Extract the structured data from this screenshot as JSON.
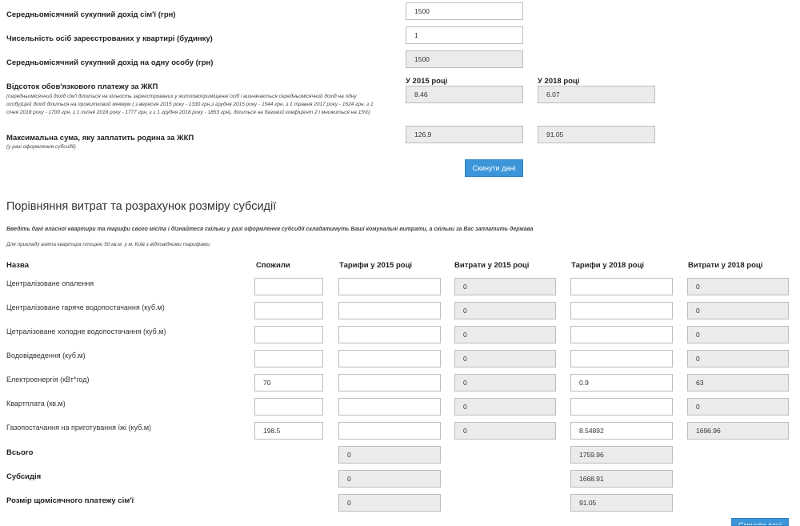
{
  "top": {
    "income_label": "Середньомісячний сукупний дохід сім'ї (грн)",
    "income_value": "1500",
    "persons_label": "Чисельність осіб зареєстрованих у квартирі (будинку)",
    "persons_value": "1",
    "per_person_label": "Середньомісячний сукупний дохід на одну особу (грн)",
    "per_person_value": "1500",
    "year_2015_label": "У 2015 році",
    "year_2018_label": "У 2018 році",
    "percent_label": "Відсоток обов'язкового платежу за ЖКП",
    "percent_note": "(середньомісячний дохід сім'ї ділиться на кількість зареєстрованих у житлово­приміщенні осіб і визначається середньомісячний дохід на одну особу)Цей дохід ділиться на прожитковий мінімум ( з вересня 2015 року - 1330 грн,з грудня 2015 року - 1544 грн, з 1 травня 2017 року - 1624 грн, з 1 січня 2018 року - 1700 грн, з 1 липня 2018 року - 1777 грн, з з 1 грудня 2018 року - 1853 грн), ділиться на базовий коефіцієнт 2 і множиться на 15%)",
    "percent_2015": "8.46",
    "percent_2018": "6.07",
    "max_label": "Максимальна сума, яку заплатить родина за ЖКП",
    "max_note": "(у разі оформлення субсидії)",
    "max_2015": "126.9",
    "max_2018": "91.05",
    "reset_label": "Скинути дані"
  },
  "section": {
    "title": "Порівняння витрат та розрахунок розміру субсидії",
    "intro": "Введіть дані власної квартири та тарифи свого міста і дізнайтеся скільки у разі оформлення субсидії складатимуть Ваші комунальні витрати, а скільки за Вас заплатить держава",
    "example": "Для прикладу взята квартира площею 50 кв.м. у м. Київ з відповідними тарифами."
  },
  "table": {
    "headers": [
      "Назва",
      "Спожили",
      "Тарифи у 2015 році",
      "Витрати у 2015 році",
      "Тарифи у 2018 році",
      "Витрати у 2018 році"
    ],
    "rows": [
      {
        "name": "Централізоване опалення",
        "consumed": "",
        "tariff_2015": "",
        "cost_2015": "0",
        "tariff_2018": "",
        "cost_2018": "0"
      },
      {
        "name": "Централізоване гаряче водопостачання (куб.м)",
        "consumed": "",
        "tariff_2015": "",
        "cost_2015": "0",
        "tariff_2018": "",
        "cost_2018": "0"
      },
      {
        "name": "Цетралізоване холодне водопостачання (куб.м)",
        "consumed": "",
        "tariff_2015": "",
        "cost_2015": "0",
        "tariff_2018": "",
        "cost_2018": "0"
      },
      {
        "name": "Водовідведення (куб.м)",
        "consumed": "",
        "tariff_2015": "",
        "cost_2015": "0",
        "tariff_2018": "",
        "cost_2018": "0"
      },
      {
        "name": "Електроенергія (кВт*год)",
        "consumed": "70",
        "tariff_2015": "",
        "cost_2015": "0",
        "tariff_2018": "0.9",
        "cost_2018": "63"
      },
      {
        "name": "Квартплата (кв.м)",
        "consumed": "",
        "tariff_2015": "",
        "cost_2015": "0",
        "tariff_2018": "",
        "cost_2018": "0"
      },
      {
        "name": "Газопостачання на приготування їжі (куб.м)",
        "consumed": "198.5",
        "tariff_2015": "",
        "cost_2015": "0",
        "tariff_2018": "8.54892",
        "cost_2018": "1696.96"
      }
    ],
    "totals": [
      {
        "label": "Всього",
        "value_2015": "0",
        "value_2018": "1759.96"
      },
      {
        "label": "Субсидія",
        "value_2015": "0",
        "value_2018": "1668.91"
      },
      {
        "label": "Розмір щомісячного платежу сім'ї",
        "value_2015": "0",
        "value_2018": "91.05"
      }
    ],
    "reset_label": "Скинути дані"
  }
}
